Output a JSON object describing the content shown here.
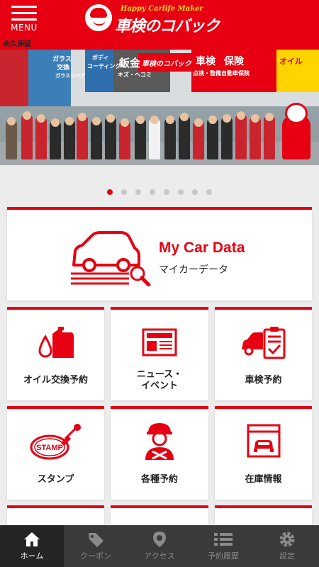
{
  "header": {
    "menu_label": "MENU",
    "logo_tagline": "Happy Carlife Maker",
    "logo_name": "車検のコバック",
    "brand_color": "#e60012"
  },
  "hero": {
    "signs": [
      "永久保証",
      "ガラス",
      "交換",
      "ボディ",
      "コーティング",
      "ガラスリペア",
      "鈑金",
      "キズ・ヘコミ",
      "車検のコバック",
      "車検",
      "保険",
      "点検・整備",
      "自動車保険",
      "オイル"
    ],
    "slide_count": 8,
    "active_slide": 1
  },
  "my_car": {
    "title": "My Car Data",
    "subtitle": "マイカーデータ",
    "icon": "car-search-icon"
  },
  "tiles": [
    {
      "label": "オイル交換予約",
      "icon": "oil-icon"
    },
    {
      "label_line1": "ニュース・",
      "label_line2": "イベント",
      "icon": "newspaper-icon"
    },
    {
      "label": "車検予約",
      "icon": "car-checklist-icon"
    },
    {
      "label": "スタンプ",
      "icon": "stamp-icon"
    },
    {
      "label": "各種予約",
      "icon": "mechanic-icon"
    },
    {
      "label": "在庫情報",
      "icon": "garage-icon"
    }
  ],
  "nav": [
    {
      "label": "ホーム",
      "icon": "home-icon",
      "active": true
    },
    {
      "label": "クーポン",
      "icon": "tag-icon",
      "active": false
    },
    {
      "label": "アクセス",
      "icon": "map-pin-icon",
      "active": false
    },
    {
      "label": "予約履歴",
      "icon": "list-icon",
      "active": false
    },
    {
      "label": "設定",
      "icon": "gear-icon",
      "active": false
    }
  ]
}
